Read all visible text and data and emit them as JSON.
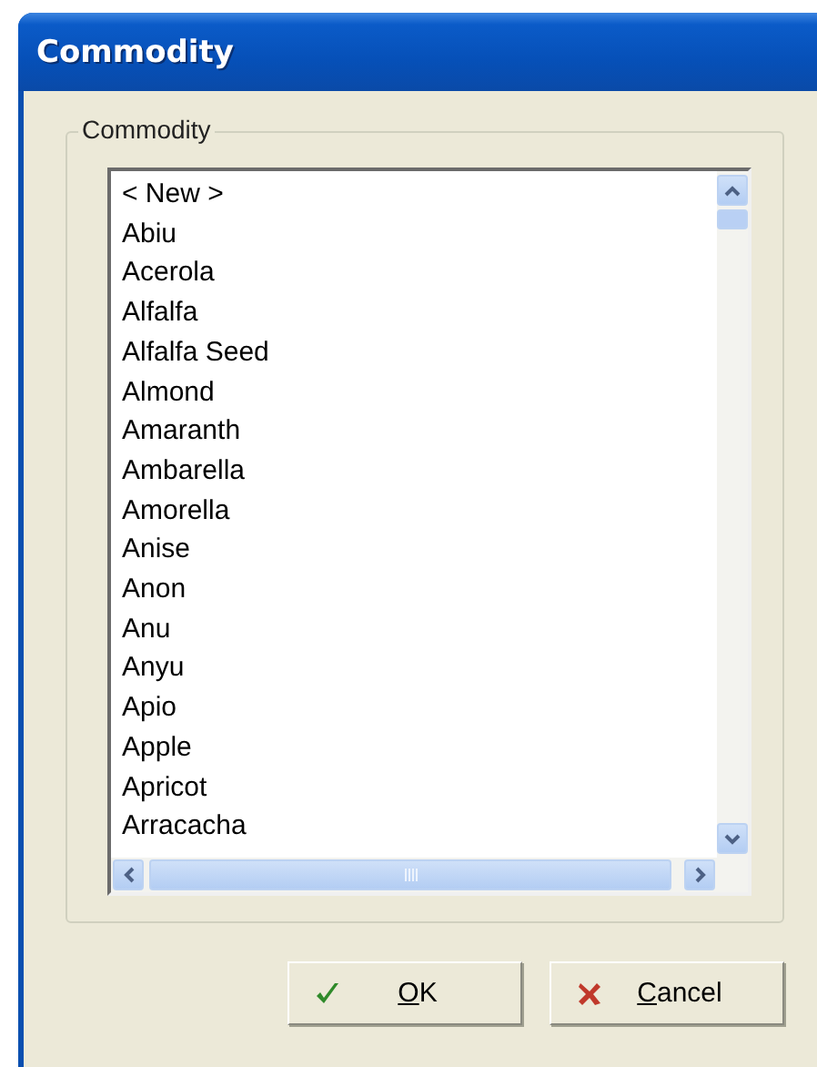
{
  "window": {
    "title": "Commodity"
  },
  "group": {
    "label": "Commodity"
  },
  "list": {
    "items": [
      {
        "label": "< New >",
        "selected": false
      },
      {
        "label": "Abiu",
        "selected": false
      },
      {
        "label": "Acerola",
        "selected": false
      },
      {
        "label": "Alfalfa",
        "selected": false
      },
      {
        "label": "Alfalfa Seed",
        "selected": false
      },
      {
        "label": "Almond",
        "selected": false
      },
      {
        "label": "Amaranth",
        "selected": false
      },
      {
        "label": "Ambarella",
        "selected": false
      },
      {
        "label": "Amorella",
        "selected": false
      },
      {
        "label": "Anise",
        "selected": false
      },
      {
        "label": "Anon",
        "selected": false
      },
      {
        "label": "Anu",
        "selected": false
      },
      {
        "label": "Anyu",
        "selected": false
      },
      {
        "label": "Apio",
        "selected": false
      },
      {
        "label": "Apple",
        "selected": false
      },
      {
        "label": "Apricot",
        "selected": false
      },
      {
        "label": "Arracacha",
        "selected": false
      }
    ]
  },
  "buttons": [
    {
      "kind": "ok",
      "label": "OK"
    },
    {
      "kind": "cancel",
      "label": "Cancel"
    }
  ]
}
